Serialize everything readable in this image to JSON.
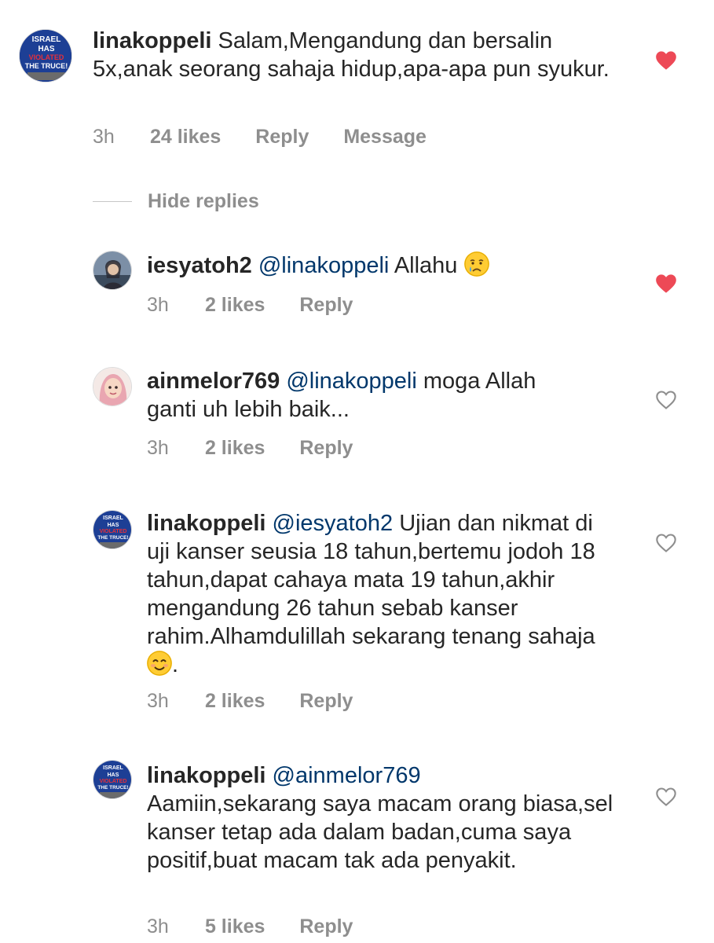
{
  "comments": [
    {
      "username": "linakoppeli",
      "mention": "",
      "text": "Salam,Mengandung dan bersalin 5x,anak seorang sahaja hidup,apa-apa pun syukur.",
      "time": "3h",
      "likes": "24 likes",
      "reply": "Reply",
      "extra": "Message",
      "liked": true,
      "avatar_text": [
        "ISRAEL",
        "HAS",
        "VIOLATED",
        "THE TRUCE!"
      ]
    },
    {
      "username": "iesyatoh2",
      "mention": "@linakoppeli",
      "text": "Allahu",
      "emoji": "crying-face",
      "time": "3h",
      "likes": "2 likes",
      "reply": "Reply",
      "liked": true
    },
    {
      "username": "ainmelor769",
      "mention": "@linakoppeli",
      "text": "moga Allah ganti uh lebih baik...",
      "time": "3h",
      "likes": "2 likes",
      "reply": "Reply",
      "liked": false
    },
    {
      "username": "linakoppeli",
      "mention": "@iesyatoh2",
      "text": "Ujian dan nikmat di uji kanser seusia 18 tahun,bertemu jodoh 18 tahun,dapat cahaya mata 19 tahun,akhir mengandung 26 tahun sebab kanser rahim.Alhamdulillah sekarang tenang sahaja",
      "text_end": ".",
      "emoji": "smiling-face",
      "time": "3h",
      "likes": "2 likes",
      "reply": "Reply",
      "liked": false,
      "avatar_text": [
        "ISRAEL",
        "HAS",
        "VIOLATED",
        "THE TRUCE!"
      ]
    },
    {
      "username": "linakoppeli",
      "mention": "@ainmelor769",
      "text": "Aamiin,sekarang saya macam orang biasa,sel kanser tetap ada dalam badan,cuma saya positif,buat macam tak ada penyakit.",
      "time": "3h",
      "likes": "5 likes",
      "reply": "Reply",
      "liked": false,
      "avatar_text": [
        "ISRAEL",
        "HAS",
        "VIOLATED",
        "THE TRUCE!"
      ]
    }
  ],
  "hide_replies": "Hide replies",
  "colors": {
    "heart_liked": "#ed4956",
    "meta": "#8e8e8e",
    "mention": "#00376b",
    "text": "#262626"
  },
  "icons": {
    "like_filled": "heart-filled-icon",
    "like_outline": "heart-outline-icon"
  }
}
